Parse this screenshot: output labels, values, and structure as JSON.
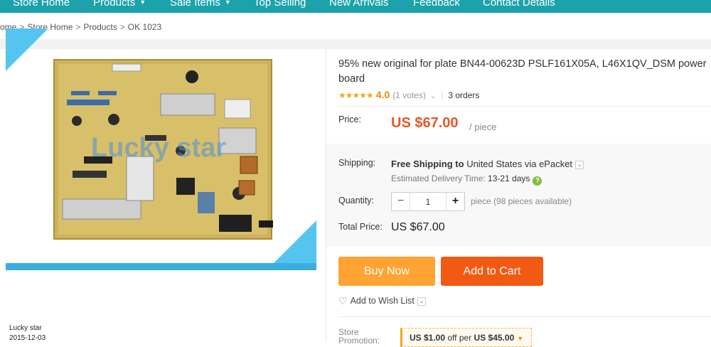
{
  "nav": {
    "items": [
      {
        "label": "Store Home",
        "has_menu": false
      },
      {
        "label": "Products",
        "has_menu": true
      },
      {
        "label": "Sale Items",
        "has_menu": true
      },
      {
        "label": "Top Selling",
        "has_menu": false
      },
      {
        "label": "New Arrivals",
        "has_menu": false
      },
      {
        "label": "Feedback",
        "has_menu": false
      },
      {
        "label": "Contact Details",
        "has_menu": false
      }
    ],
    "caret": "▼"
  },
  "breadcrumb": {
    "items": [
      "ome",
      "Store Home",
      "Products",
      "OK 1023"
    ],
    "separator": ">"
  },
  "image": {
    "watermark": "Lucky star",
    "seller_name": "Lucky star",
    "date": "2015-12-03"
  },
  "product": {
    "title": "95% new original for plate BN44-00623D PSLF161X05A, L46X1QV_DSM power board",
    "rating": {
      "stars_filled": 4,
      "stars_text": "★★★★★",
      "score": "4.0",
      "votes": "(1 votes)",
      "chevron": "⌄",
      "orders": "3 orders"
    }
  },
  "price": {
    "label": "Price:",
    "value": "US $67.00",
    "unit": "/ piece"
  },
  "shipping": {
    "label": "Shipping:",
    "free": "Free Shipping to",
    "destination": "United States via ePacket",
    "delivery_label": "Estimated Delivery Time:",
    "delivery_days": "13-21 days",
    "help": "?"
  },
  "quantity": {
    "label": "Quantity:",
    "value": "1",
    "minus": "−",
    "plus": "+",
    "available": "piece (98 pieces available)"
  },
  "total": {
    "label": "Total Price:",
    "value": "US $67.00"
  },
  "actions": {
    "buy_now": "Buy Now",
    "add_to_cart": "Add to Cart",
    "wish_list": "Add to Wish List"
  },
  "promotion": {
    "label_line1": "Store",
    "label_line2": "Promotion:",
    "pre": "US $1.00",
    "mid": " off per ",
    "post": "US $45.00"
  },
  "colors": {
    "nav": "#1ba2aa",
    "price": "#e8572a",
    "buy_now": "#ffa332",
    "add_to_cart": "#f25a14",
    "stars": "#f4a623",
    "image_corner": "#55c5f0"
  },
  "icons": [
    "heart-icon",
    "help-icon",
    "chevron-down-icon",
    "caret-down-icon",
    "minus-icon",
    "plus-icon"
  ]
}
